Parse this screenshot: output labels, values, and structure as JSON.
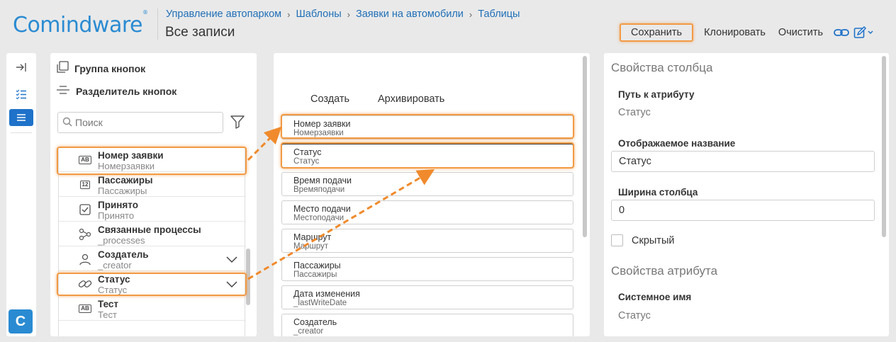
{
  "header": {
    "logo": "Comindware",
    "logo_mark": "®",
    "breadcrumb": [
      "Управление автопарком",
      "Шаблоны",
      "Заявки на автомобили",
      "Таблицы"
    ],
    "title": "Все записи"
  },
  "toolbar": {
    "save": "Сохранить",
    "clone": "Клонировать",
    "clear": "Очистить"
  },
  "rail": {
    "badge": "C"
  },
  "attributes_panel": {
    "button_group": "Группа кнопок",
    "button_separator": "Разделитель кнопок",
    "search_placeholder": "Поиск",
    "items": [
      {
        "name": "Номер заявки",
        "system": "Номерзаявки",
        "icon": "text-ab-icon"
      },
      {
        "name": "Пассажиры",
        "system": "Пассажиры",
        "icon": "number-12-icon"
      },
      {
        "name": "Принято",
        "system": "Принято",
        "icon": "checkbox-icon"
      },
      {
        "name": "Связанные процессы",
        "system": "_processes",
        "icon": "process-icon"
      },
      {
        "name": "Создатель",
        "system": "_creator",
        "icon": "user-icon"
      },
      {
        "name": "Статус",
        "system": "Статус",
        "icon": "link-icon"
      },
      {
        "name": "Тест",
        "system": "Тест",
        "icon": "text-ab-icon"
      }
    ]
  },
  "columns_panel": {
    "create": "Создать",
    "archive": "Архивировать",
    "columns": [
      {
        "title": "Номер заявки",
        "system": "Номерзаявки"
      },
      {
        "title": "Статус",
        "system": "Статус"
      },
      {
        "title": "Время подачи",
        "system": "Времяподачи"
      },
      {
        "title": "Место подачи",
        "system": "Местоподачи"
      },
      {
        "title": "Маршрут",
        "system": "Маршрут"
      },
      {
        "title": "Пассажиры",
        "system": "Пассажиры"
      },
      {
        "title": "Дата изменения",
        "system": "_lastWriteDate"
      },
      {
        "title": "Создатель",
        "system": "_creator"
      }
    ]
  },
  "properties_panel": {
    "column_props_title": "Свойства столбца",
    "attr_path_label": "Путь к атрибуту",
    "attr_path_value": "Статус",
    "display_name_label": "Отображаемое название",
    "display_name_value": "Статус",
    "width_label": "Ширина столбца",
    "width_value": "0",
    "hidden_label": "Скрытый",
    "attr_props_title": "Свойства атрибута",
    "system_name_label": "Системное имя",
    "system_name_value": "Статус"
  },
  "colors": {
    "accent": "#2a8bd2",
    "link": "#1f6fb8",
    "highlight": "#f29a45",
    "active_rail": "#1f72c9"
  }
}
